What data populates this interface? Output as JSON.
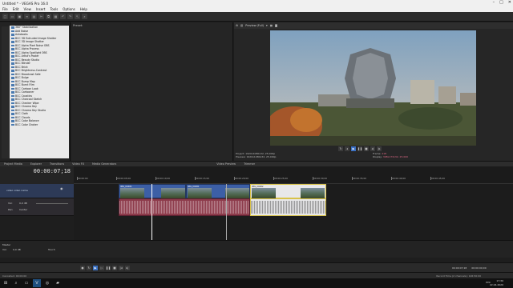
{
  "window": {
    "title": "Untitled * - VEGAS Pro 16.0"
  },
  "menu": [
    "File",
    "Edit",
    "View",
    "Insert",
    "Tools",
    "Options",
    "Help"
  ],
  "effects": {
    "items": [
      "360° Stabilization",
      "Add Noise",
      "Autolooks",
      "BCC 3D Extruded Image Shatter",
      "BCC 3D Image Shatter",
      "BCC Alpha Pixel Noise OBS",
      "BCC Alpha Process",
      "BCC Alpha Spotlight OBS",
      "BCC Artist's Poster",
      "BCC Beauty Studio",
      "BCC Blinder",
      "BCC Brick",
      "BCC Brightness-Contrast",
      "BCC Broadcast Safe",
      "BCC Bulge",
      "BCC Bump Map",
      "BCC Burnt Film",
      "BCC Cartoon Look",
      "BCC Cartooner",
      "BCC Caustics",
      "BCC Charcoal Sketch",
      "BCC Checker Wipe",
      "BCC Chroma Key",
      "BCC Chroma Key Studio",
      "BCC Cloth",
      "BCC Clouds",
      "BCC Color Balance",
      "BCC Color Choker"
    ]
  },
  "preset": {
    "label": "Preset:"
  },
  "preview": {
    "quality": "Preview (Full)",
    "project": "Project: 1920x1080x32, 25.000p",
    "preview_res": "Preview: 1920x1080x32, 25.000p",
    "display": "Video Preview",
    "frame_label": "Frame:",
    "frame_value": "218",
    "display_label": "Display:",
    "display_value": "308x173x32, 25.000"
  },
  "tabs": [
    "Project Media",
    "Explorer",
    "Transitions",
    "Video FX",
    "Media Generators",
    "Video Preview",
    "Trimmer"
  ],
  "timeline": {
    "timecode": "00:00:07;18",
    "track_video_name": "video video name",
    "vol_label": "Vol:",
    "vol_value": "0,0 dB",
    "pan_label": "Pan:",
    "pan_value": "Center",
    "rate": "Rate: 1,00",
    "master_label": "Master",
    "touch": "Touch",
    "ruler": [
      "00:00:00",
      "00:00:05;00",
      "00:00:10;00",
      "00:00:15;00",
      "00:00:20;00",
      "00:00:25;00",
      "00:00:30;00",
      "00:00:35;00",
      "00:00:40;00",
      "00:00:45;00"
    ],
    "clips": [
      "IMG_00481",
      "IMG_00481",
      "IMG_00482"
    ],
    "end_time": "00:00:07;18",
    "length": "00:00:00;00"
  },
  "status": {
    "left": "Cancelled: 00:00:00",
    "record": "Record Time (2 channels): 126:50:00"
  },
  "clock": {
    "time": "17:30",
    "date": "22.04.2020",
    "lang": "РУС"
  }
}
